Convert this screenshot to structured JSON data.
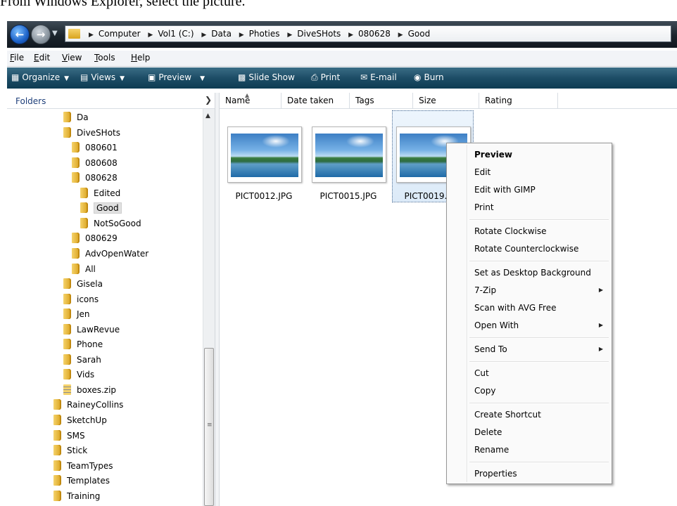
{
  "caption": "From Windows Explorer, select the picture.",
  "breadcrumbs": [
    "Computer",
    "Vol1 (C:)",
    "Data",
    "Photies",
    "DiveSHots",
    "080628",
    "Good"
  ],
  "menu": {
    "file": {
      "u": "F",
      "rest": "ile"
    },
    "edit": {
      "u": "E",
      "rest": "dit"
    },
    "view": {
      "u": "V",
      "rest": "iew"
    },
    "tools": {
      "u": "T",
      "rest": "ools"
    },
    "help": {
      "u": "H",
      "rest": "elp"
    }
  },
  "toolbar": {
    "organize": "Organize",
    "views": "Views",
    "preview": "Preview",
    "slideshow": "Slide Show",
    "print": "Print",
    "email": "E-mail",
    "burn": "Burn"
  },
  "folders_label": "Folders",
  "tree": [
    {
      "label": "Da",
      "indent": 1
    },
    {
      "label": "DiveSHots",
      "indent": 1
    },
    {
      "label": "080601",
      "indent": 2
    },
    {
      "label": "080608",
      "indent": 2
    },
    {
      "label": "080628",
      "indent": 2
    },
    {
      "label": "Edited",
      "indent": 3
    },
    {
      "label": "Good",
      "indent": 3,
      "selected": true
    },
    {
      "label": "NotSoGood",
      "indent": 3
    },
    {
      "label": "080629",
      "indent": 2
    },
    {
      "label": "AdvOpenWater",
      "indent": 2
    },
    {
      "label": "All",
      "indent": 2
    },
    {
      "label": "Gisela",
      "indent": 1
    },
    {
      "label": "icons",
      "indent": 1
    },
    {
      "label": "Jen",
      "indent": 1
    },
    {
      "label": "LawRevue",
      "indent": 1
    },
    {
      "label": "Phone",
      "indent": 1
    },
    {
      "label": "Sarah",
      "indent": 1
    },
    {
      "label": "Vids",
      "indent": 1
    },
    {
      "label": "boxes.zip",
      "indent": 1,
      "zip": true
    },
    {
      "label": "RaineyCollins",
      "indent": 0
    },
    {
      "label": "SketchUp",
      "indent": 0
    },
    {
      "label": "SMS",
      "indent": 0
    },
    {
      "label": "Stick",
      "indent": 0
    },
    {
      "label": "TeamTypes",
      "indent": 0
    },
    {
      "label": "Templates",
      "indent": 0
    },
    {
      "label": "Training",
      "indent": 0
    }
  ],
  "columns": {
    "name": "Name",
    "date_taken": "Date taken",
    "tags": "Tags",
    "size": "Size",
    "rating": "Rating"
  },
  "files": [
    "PICT0012.JPG",
    "PICT0015.JPG",
    "PICT0019.JPG"
  ],
  "context_menu": {
    "preview": "Preview",
    "edit": "Edit",
    "edit_gimp": "Edit with GIMP",
    "print": "Print",
    "rotate_cw": "Rotate Clockwise",
    "rotate_ccw": "Rotate Counterclockwise",
    "set_desktop": "Set as Desktop Background",
    "zip": "7-Zip",
    "scan": "Scan with AVG Free",
    "open_with": "Open With",
    "send_to": "Send To",
    "cut": "Cut",
    "copy": "Copy",
    "create_shortcut": "Create Shortcut",
    "delete": "Delete",
    "rename": "Rename",
    "properties": "Properties"
  }
}
